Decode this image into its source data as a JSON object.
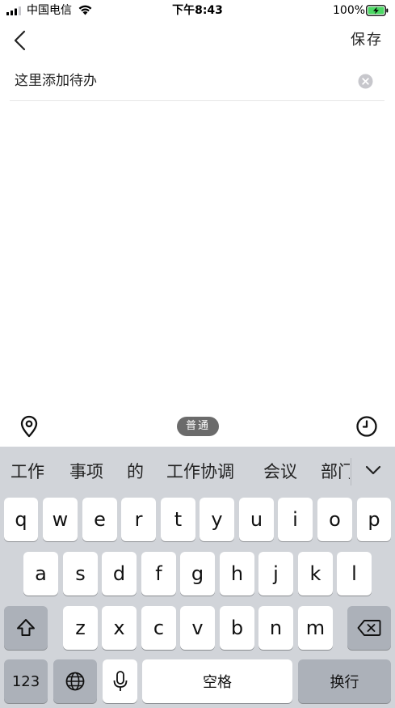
{
  "status_bar": {
    "carrier": "中国电信",
    "time": "下午8:43",
    "battery": "100%"
  },
  "nav": {
    "back_icon": "chevron-left-icon",
    "save_label": "保存"
  },
  "todo_input": {
    "placeholder": "这里添加待办",
    "value": ""
  },
  "toolbar": {
    "location_icon": "location-pin-icon",
    "mode_label": "普通",
    "reminder_icon": "clock-icon"
  },
  "keyboard": {
    "candidates": [
      "工作",
      "事项",
      "的",
      "工作协调",
      "会议",
      "部门"
    ],
    "row1": [
      "q",
      "w",
      "e",
      "r",
      "t",
      "y",
      "u",
      "i",
      "o",
      "p"
    ],
    "row2": [
      "a",
      "s",
      "d",
      "f",
      "g",
      "h",
      "j",
      "k",
      "l"
    ],
    "row3": [
      "z",
      "x",
      "c",
      "v",
      "b",
      "n",
      "m"
    ],
    "numbers_label": "123",
    "space_label": "空格",
    "return_label": "换行"
  },
  "colors": {
    "keyboard_bg": "#d1d4d9",
    "key_bg": "#ffffff",
    "key_dark_bg": "#acb1b9",
    "badge_bg": "#6b6b6b",
    "battery_green": "#4cd964"
  }
}
